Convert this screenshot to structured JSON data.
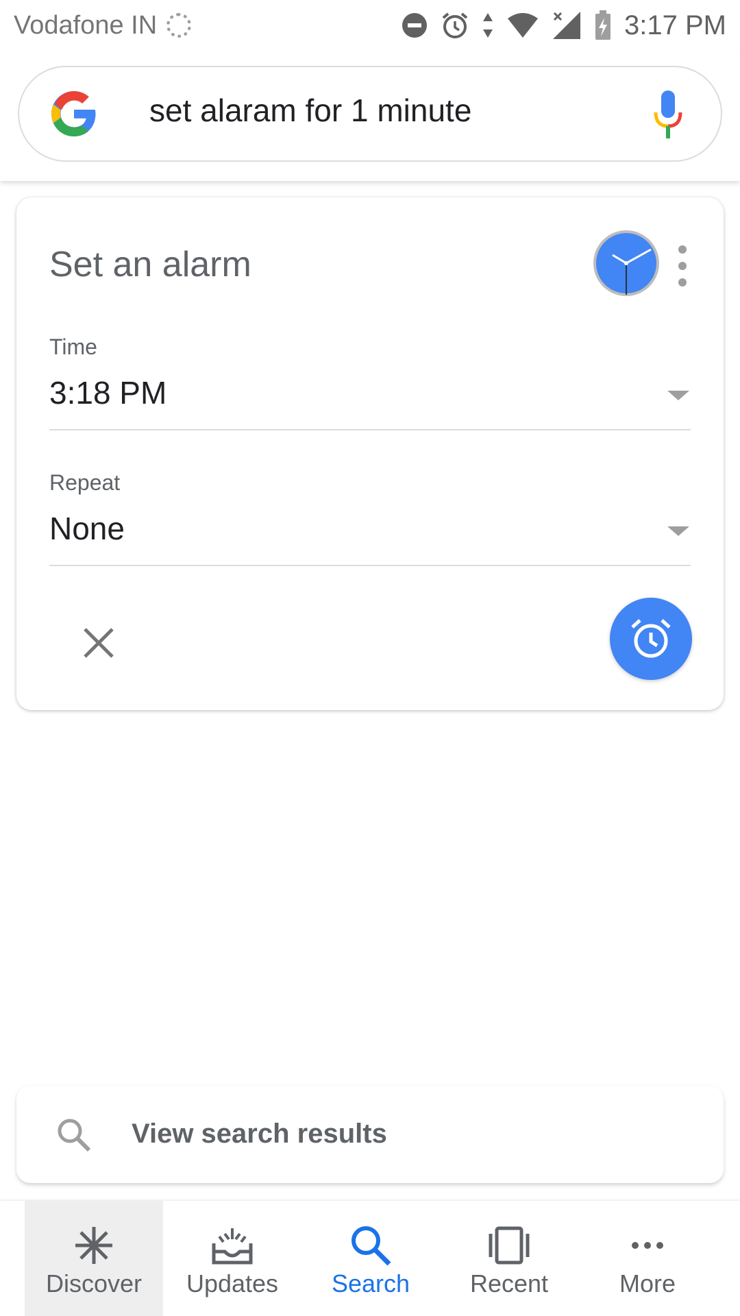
{
  "status_bar": {
    "carrier": "Vodafone IN",
    "time": "3:17 PM",
    "icons": [
      "loading-icon",
      "do-not-disturb-icon",
      "alarm-icon",
      "data-arrows-icon",
      "wifi-icon",
      "no-signal-icon",
      "battery-charging-icon"
    ]
  },
  "search": {
    "query": "set alaram for 1 minute",
    "logo": "google-g-logo",
    "mic_icon": "mic-icon"
  },
  "alarm_card": {
    "title": "Set an alarm",
    "time_label": "Time",
    "time_value": "3:18 PM",
    "repeat_label": "Repeat",
    "repeat_value": "None",
    "accent_color": "#4285f4"
  },
  "results_bar": {
    "label": "View search results"
  },
  "bottom_nav": {
    "items": [
      {
        "label": "Discover",
        "icon": "asterisk-icon"
      },
      {
        "label": "Updates",
        "icon": "inbox-icon"
      },
      {
        "label": "Search",
        "icon": "search-icon"
      },
      {
        "label": "Recent",
        "icon": "recent-icon"
      },
      {
        "label": "More",
        "icon": "more-dots-icon"
      }
    ],
    "selected": "Search",
    "selected_color": "#1a73e8"
  }
}
